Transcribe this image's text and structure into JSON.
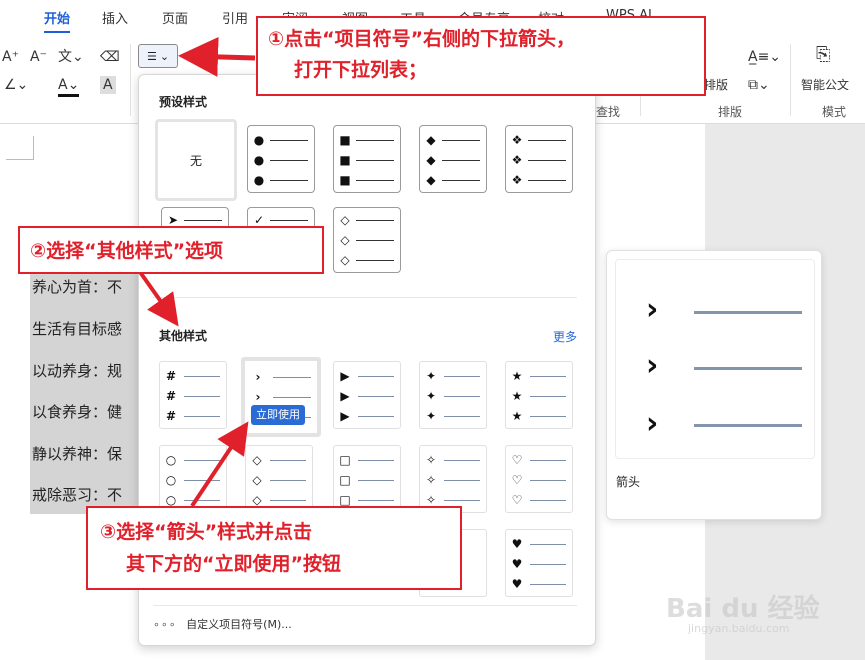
{
  "ribbon": {
    "tabs": [
      "开始",
      "插入",
      "页面",
      "引用",
      "审阅",
      "视图",
      "工具",
      "会员专享",
      "校对",
      "WPS AI"
    ],
    "group_labels": {
      "find": "查找",
      "arrange": "排版",
      "mode": "模式"
    },
    "arrange_btn": "排版",
    "smart_doc_btn": "智能公文"
  },
  "dropdown": {
    "preset_title": "预设样式",
    "none_label": "无",
    "other_title": "其他样式",
    "more_label": "更多",
    "use_now_label": "立即使用",
    "footer_label": "自定义项目符号(M)...",
    "footer_dots": "∘∘∘"
  },
  "document": {
    "lines": [
      "养心为首：不",
      "生活有目标感",
      "以动养身：规",
      "以食养身：健",
      "静以养神：保",
      "戒除恶习：不"
    ]
  },
  "preview": {
    "label": "箭头"
  },
  "annotations": {
    "step1": [
      "①点击“项目符号”右侧的下拉箭头，",
      "打开下拉列表；"
    ],
    "step2": "②选择“其他样式”选项",
    "step3": [
      "③选择“箭头”样式并点击",
      "其下方的“立即使用”按钮"
    ]
  },
  "watermark": {
    "brand": "Bai du 经验",
    "url": "jingyan.baidu.com"
  },
  "colors": {
    "accent": "#1f5fd6",
    "annotation": "#e0202a",
    "button": "#2a6bd6"
  }
}
